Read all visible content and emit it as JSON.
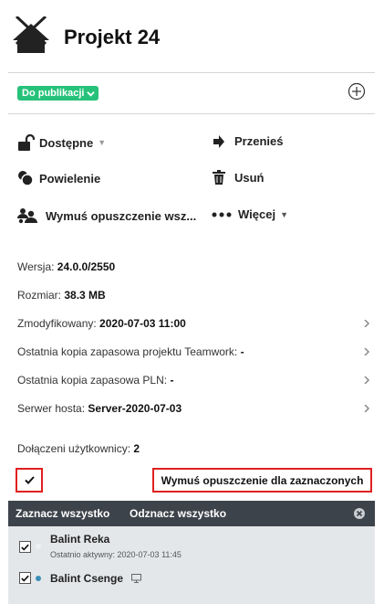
{
  "header": {
    "title": "Projekt 24",
    "icon": "house-icon"
  },
  "status": {
    "label": "Do publikacji"
  },
  "actions": {
    "available": "Dostępne",
    "move": "Przenieś",
    "duplicate": "Powielenie",
    "delete": "Usuń",
    "force_leave": "Wymuś opuszczenie wsz...",
    "more": "Więcej"
  },
  "info": {
    "version_label": "Wersja:",
    "version_value": "24.0.0/2550",
    "size_label": "Rozmiar:",
    "size_value": "38.3 MB",
    "modified_label": "Zmodyfikowany:",
    "modified_value": "2020-07-03 11:00",
    "tw_backup_label": "Ostatnia kopia zapasowa projektu Teamwork:",
    "tw_backup_value": "-",
    "pln_backup_label": "Ostatnia kopia zapasowa PLN:",
    "pln_backup_value": "-",
    "host_label": "Serwer hosta:",
    "host_value": "Server-2020-07-03"
  },
  "users": {
    "joined_label": "Dołączeni użytkownicy:",
    "joined_count": "2",
    "force_button": "Wymuś opuszczenie dla zaznaczonych",
    "select_all": "Zaznacz wszystko",
    "deselect_all": "Odznacz wszystko",
    "list": [
      {
        "name": "Balint Reka",
        "last_active": "Ostatnio aktywny: 2020-07-03 11:45",
        "online": false
      },
      {
        "name": "Balint Csenge",
        "last_active": "",
        "online": true
      }
    ]
  },
  "colors": {
    "accent_green": "#27c27a",
    "highlight_red": "#e02020",
    "online_dot": "#3a8fb7",
    "bar_dark": "#3d434a"
  }
}
